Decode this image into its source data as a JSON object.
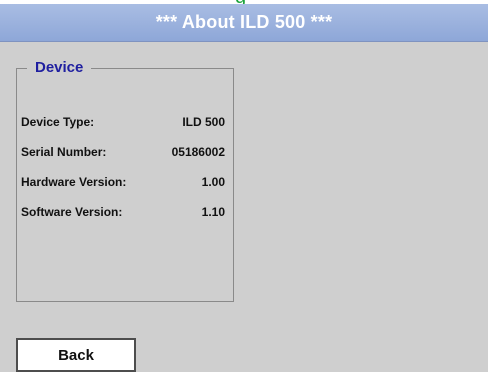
{
  "cropped_top_text": "g",
  "window": {
    "title": "*** About ILD 500 ***"
  },
  "device_group": {
    "legend": "Device",
    "rows": [
      {
        "label": "Device Type:",
        "value": "ILD 500"
      },
      {
        "label": "Serial Number:",
        "value": "05186002"
      },
      {
        "label": "Hardware Version:",
        "value": "1.00"
      },
      {
        "label": "Software Version:",
        "value": "1.10"
      }
    ]
  },
  "buttons": {
    "back_label": "Back"
  },
  "colors": {
    "titlebar": "#9fb5e0",
    "screen_bg": "#cfcfcf",
    "legend_text": "#1f1fa0",
    "cropped_text": "#1aa33a"
  }
}
